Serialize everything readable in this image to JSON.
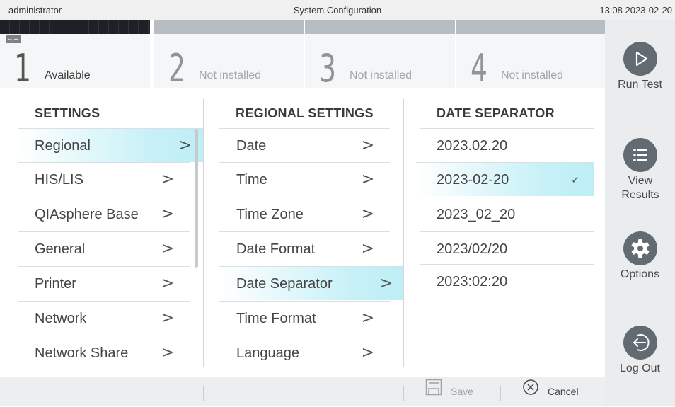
{
  "statusbar": {
    "user": "administrator",
    "title": "System Configuration",
    "clock": "13:08 2023-02-20"
  },
  "modules": [
    {
      "number": "1",
      "status": "Available",
      "timer": "--:--"
    },
    {
      "number": "2",
      "status": "Not installed"
    },
    {
      "number": "3",
      "status": "Not installed"
    },
    {
      "number": "4",
      "status": "Not installed"
    }
  ],
  "sidenav": [
    {
      "label": "Run Test",
      "icon": "play-icon"
    },
    {
      "label": "View Results",
      "icon": "list-icon"
    },
    {
      "label": "Options",
      "icon": "gear-icon"
    },
    {
      "label": "Log Out",
      "icon": "logout-icon"
    }
  ],
  "settings": {
    "header": "SETTINGS",
    "items": [
      "Regional",
      "HIS/LIS",
      "QIAsphere Base",
      "General",
      "Printer",
      "Network",
      "Network Share"
    ],
    "selected": "Regional"
  },
  "regional": {
    "header": "REGIONAL SETTINGS",
    "items": [
      "Date",
      "Time",
      "Time Zone",
      "Date Format",
      "Date Separator",
      "Time Format",
      "Language"
    ],
    "selected": "Date Separator"
  },
  "separator": {
    "header": "DATE SEPARATOR",
    "options": [
      "2023.02.20",
      "2023-02-20",
      "2023_02_20",
      "2023/02/20",
      "2023:02:20"
    ],
    "selected": "2023-02-20"
  },
  "footer": {
    "save_label": "Save",
    "cancel_label": "Cancel"
  },
  "colors": {
    "accent": "#bdeef6",
    "nav_icon": "#626b72"
  }
}
